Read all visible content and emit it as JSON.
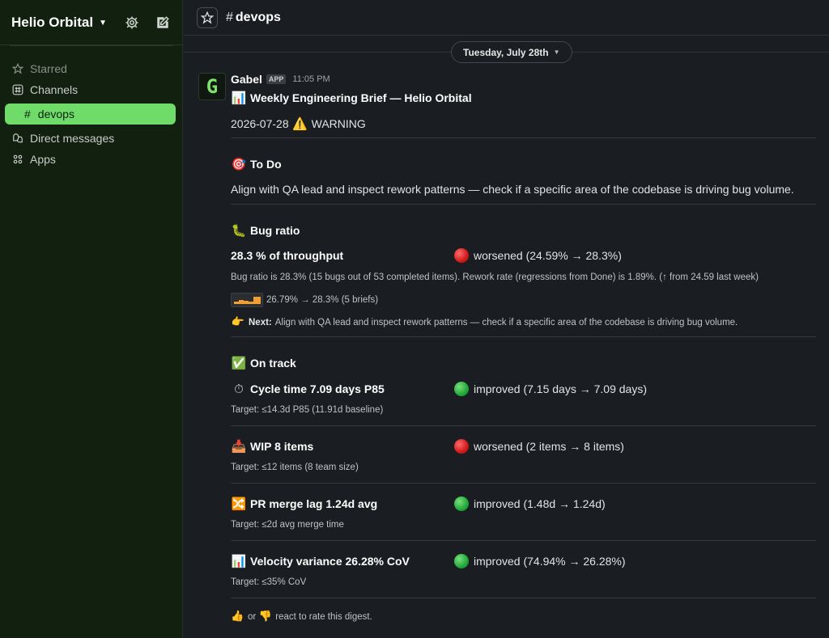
{
  "workspace": {
    "name": "Helio Orbital"
  },
  "sidebar": {
    "items": [
      {
        "label": "Starred"
      },
      {
        "label": "Channels"
      },
      {
        "label": "devops"
      },
      {
        "label": "Direct messages"
      },
      {
        "label": "Apps"
      }
    ]
  },
  "channel": {
    "name": "devops",
    "hash": "#"
  },
  "date_divider": "Tuesday, July 28th",
  "message": {
    "sender": "Gabel",
    "badge": "APP",
    "time": "11:05 PM",
    "avatar_letter": "G",
    "title": "Weekly Engineering Brief — Helio Orbital",
    "status_line": "2026-07-28",
    "status_word": "WARNING",
    "todo_heading": "To Do",
    "todo_text": "Align with QA lead and inspect rework patterns — check if a specific area of the codebase is driving bug volume.",
    "bug": {
      "heading": "Bug ratio",
      "metric": "28.3 % of throughput",
      "trend": "worsened (24.59% → 28.3%)",
      "detail": "Bug ratio is 28.3% (15 bugs out of 53 completed items). Rework rate (regressions from Done) is 1.89%. (↑ from 24.59 last week)",
      "spark_text": "26.79% → 28.3% (5 briefs)",
      "next_label": "Next:",
      "next_text": "Align with QA lead and inspect rework patterns — check if a specific area of the codebase is driving bug volume."
    },
    "on_track_heading": "On track",
    "metrics": [
      {
        "name": "Cycle time 7.09 days P85",
        "trend": "improved (7.15 days → 7.09 days)",
        "status": "green",
        "target": "Target: ≤14.3d P85 (11.91d baseline)"
      },
      {
        "name": "WIP 8 items",
        "trend": "worsened (2 items → 8 items)",
        "status": "red",
        "target": "Target: ≤12 items (8 team size)"
      },
      {
        "name": "PR merge lag 1.24d avg",
        "trend": "improved (1.48d → 1.24d)",
        "status": "green",
        "target": "Target: ≤2d avg merge time"
      },
      {
        "name": "Velocity variance 26.28% CoV",
        "trend": "improved (74.94% → 26.28%)",
        "status": "green",
        "target": "Target: ≤35% CoV"
      }
    ],
    "footer_or": "or",
    "footer_text": "react to rate this digest."
  },
  "colors": {
    "accent": "#6fdc6a",
    "sidebar_bg": "#11200f",
    "main_bg": "#1a1d21",
    "red": "#d11a1a",
    "green": "#22a83a"
  },
  "icons": [
    "gear-icon",
    "compose-icon",
    "star-icon",
    "hash-icon",
    "chart-icon",
    "warning-icon",
    "dart-icon",
    "bug-icon",
    "check-icon",
    "stopwatch-icon",
    "inbox-icon",
    "shuffle-icon",
    "thumbs-up-icon",
    "thumbs-down-icon",
    "pointing-hand-icon"
  ]
}
